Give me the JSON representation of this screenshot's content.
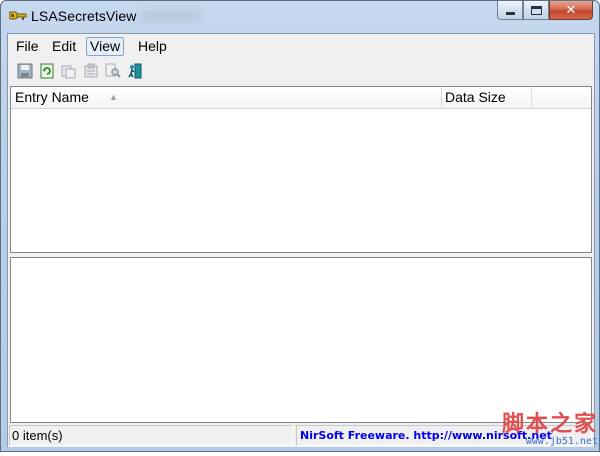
{
  "window": {
    "title": "LSASecretsView"
  },
  "menu": {
    "items": [
      "File",
      "Edit",
      "View",
      "Help"
    ],
    "active": "View"
  },
  "toolbar": {
    "buttons": [
      "save-icon",
      "refresh-icon",
      "copy-icon",
      "properties-icon",
      "find-icon",
      "exit-icon"
    ]
  },
  "list": {
    "columns": [
      "Entry Name",
      "Data Size"
    ]
  },
  "status": {
    "count": "0 item(s)",
    "link": "NirSoft Freeware.  http://www.nirsoft.net"
  },
  "watermark": {
    "main": "脚本之家",
    "sub": "www.jb51.net"
  },
  "colors": {
    "accent": "#0000ee",
    "watermark_red": "#e05050",
    "watermark_blue": "#3d6fd0"
  }
}
